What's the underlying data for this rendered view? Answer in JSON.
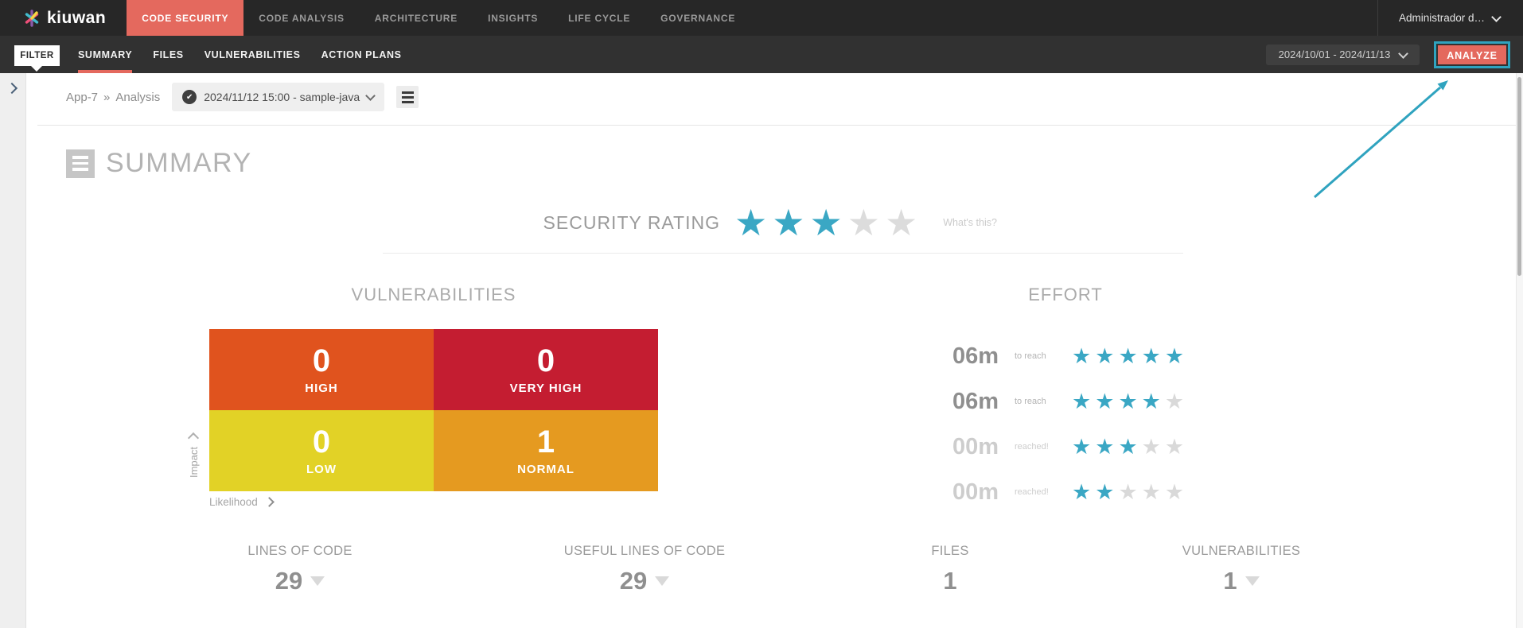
{
  "topnav": {
    "brand": "kiuwan",
    "items": [
      {
        "label": "CODE SECURITY",
        "active": true
      },
      {
        "label": "CODE ANALYSIS",
        "active": false
      },
      {
        "label": "ARCHITECTURE",
        "active": false
      },
      {
        "label": "INSIGHTS",
        "active": false
      },
      {
        "label": "LIFE CYCLE",
        "active": false
      },
      {
        "label": "GOVERNANCE",
        "active": false
      }
    ],
    "user_label": "Administrador d…"
  },
  "subnav": {
    "filter_label": "FILTER",
    "tabs": [
      {
        "label": "SUMMARY",
        "active": true
      },
      {
        "label": "FILES",
        "active": false
      },
      {
        "label": "VULNERABILITIES",
        "active": false
      },
      {
        "label": "ACTION PLANS",
        "active": false
      }
    ],
    "date_range": "2024/10/01 - 2024/11/13",
    "analyze_label": "ANALYZE"
  },
  "breadcrumb": {
    "app": "App-7",
    "separator": "»",
    "section": "Analysis"
  },
  "analysis_selector": {
    "value": "2024/11/12 15:00 - sample-java"
  },
  "page": {
    "title": "SUMMARY"
  },
  "security_rating": {
    "label": "SECURITY RATING",
    "stars": {
      "filled": 3,
      "total": 5
    },
    "whats_this": "What's this?"
  },
  "vulnerabilities_chart": {
    "title": "VULNERABILITIES",
    "y_axis": "Impact",
    "x_axis": "Likelihood",
    "cells": [
      {
        "key": "high",
        "label": "HIGH",
        "value": "0",
        "color": "#e0531e"
      },
      {
        "key": "very_high",
        "label": "VERY HIGH",
        "value": "0",
        "color": "#c41d31"
      },
      {
        "key": "low",
        "label": "LOW",
        "value": "0",
        "color": "#e2d226"
      },
      {
        "key": "normal",
        "label": "NORMAL",
        "value": "1",
        "color": "#e59a20"
      }
    ]
  },
  "effort": {
    "title": "EFFORT",
    "rows": [
      {
        "time": "06m",
        "note": "to reach",
        "stars": {
          "filled": 5,
          "total": 5
        },
        "reached": false
      },
      {
        "time": "06m",
        "note": "to reach",
        "stars": {
          "filled": 4,
          "total": 5
        },
        "reached": false
      },
      {
        "time": "00m",
        "note": "reached!",
        "stars": {
          "filled": 3,
          "total": 5
        },
        "reached": true
      },
      {
        "time": "00m",
        "note": "reached!",
        "stars": {
          "filled": 2,
          "total": 5
        },
        "reached": true
      }
    ]
  },
  "stats": [
    {
      "label": "LINES OF CODE",
      "value": "29",
      "trend": "down"
    },
    {
      "label": "USEFUL LINES OF CODE",
      "value": "29",
      "trend": "down"
    },
    {
      "label": "FILES",
      "value": "1",
      "trend": null
    },
    {
      "label": "VULNERABILITIES",
      "value": "1",
      "trend": "down"
    }
  ],
  "colors": {
    "accent_red": "#e4695e",
    "star_teal": "#3aa7c4",
    "annotation_teal": "#2fa3bf",
    "navbar_bg": "#272727",
    "subnav_bg": "#313131",
    "quadrant_high": "#e0531e",
    "quadrant_very_high": "#c41d31",
    "quadrant_low": "#e2d226",
    "quadrant_normal": "#e59a20"
  }
}
